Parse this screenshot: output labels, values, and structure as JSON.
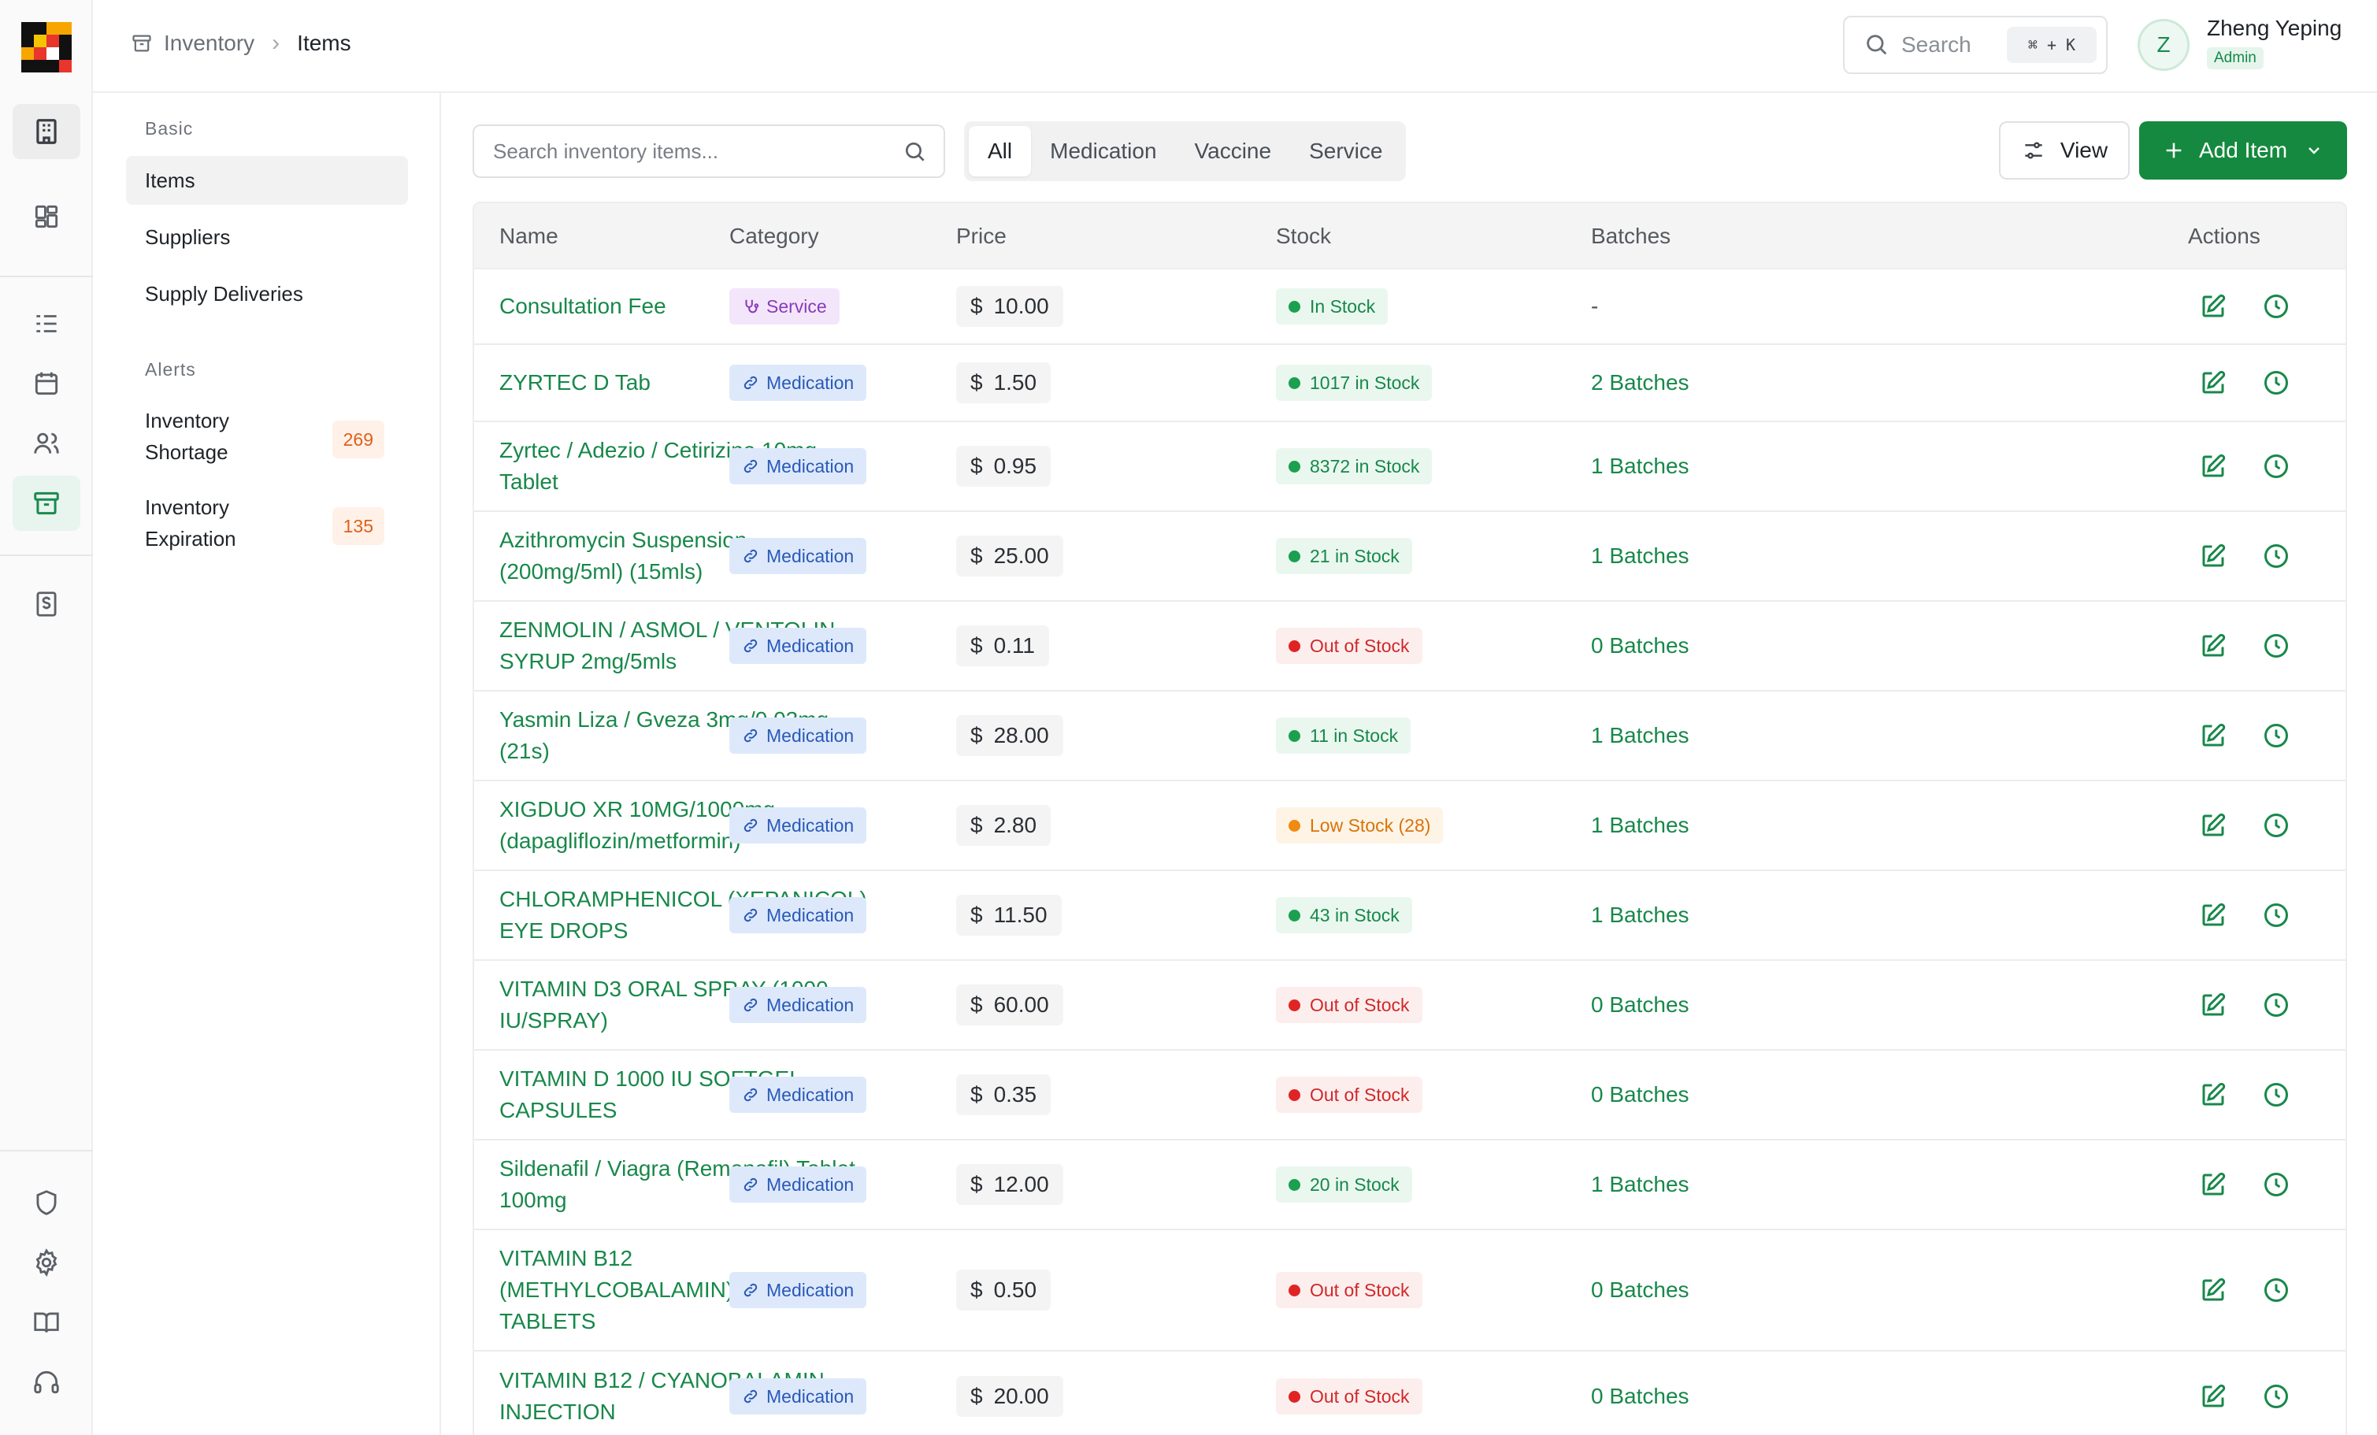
{
  "breadcrumb": {
    "section": "Inventory",
    "page": "Items"
  },
  "header": {
    "search_label": "Search",
    "shortcut": "⌘ + K",
    "user": {
      "initial": "Z",
      "name": "Zheng Yeping",
      "role": "Admin"
    }
  },
  "subnav": {
    "basic_heading": "Basic",
    "basic_items": [
      "Items",
      "Suppliers",
      "Supply Deliveries"
    ],
    "alerts_heading": "Alerts",
    "alerts": [
      {
        "line1": "Inventory",
        "line2": "Shortage",
        "count": "269"
      },
      {
        "line1": "Inventory",
        "line2": "Expiration",
        "count": "135"
      }
    ]
  },
  "toolbar": {
    "search_placeholder": "Search inventory items...",
    "tabs": [
      "All",
      "Medication",
      "Vaccine",
      "Service"
    ],
    "view_label": "View",
    "add_label": "Add Item"
  },
  "table": {
    "columns": [
      "Name",
      "Category",
      "Price",
      "Stock",
      "Batches",
      "Actions"
    ],
    "currency": "$",
    "rows": [
      {
        "name": "Consultation Fee",
        "category": "Service",
        "price": "10.00",
        "stock": "In Stock",
        "stock_level": "green",
        "batches": "-"
      },
      {
        "name": "ZYRTEC D Tab",
        "category": "Medication",
        "price": "1.50",
        "stock": "1017 in Stock",
        "stock_level": "green",
        "batches": "2 Batches"
      },
      {
        "name": "Zyrtec / Adezio / Cetirizine 10mg Tablet",
        "category": "Medication",
        "price": "0.95",
        "stock": "8372 in Stock",
        "stock_level": "green",
        "batches": "1 Batches"
      },
      {
        "name": "Azithromycin Suspension (200mg/5ml) (15mls)",
        "category": "Medication",
        "price": "25.00",
        "stock": "21 in Stock",
        "stock_level": "green",
        "batches": "1 Batches"
      },
      {
        "name": "ZENMOLIN / ASMOL / VENTOLIN SYRUP 2mg/5mls",
        "category": "Medication",
        "price": "0.11",
        "stock": "Out of Stock",
        "stock_level": "red",
        "batches": "0 Batches"
      },
      {
        "name": "Yasmin Liza / Gveza 3mg/0.03mg (21s)",
        "category": "Medication",
        "price": "28.00",
        "stock": "11 in Stock",
        "stock_level": "green",
        "batches": "1 Batches"
      },
      {
        "name": "XIGDUO XR 10MG/1000mg (dapagliflozin/metformin)",
        "category": "Medication",
        "price": "2.80",
        "stock": "Low Stock (28)",
        "stock_level": "orange",
        "batches": "1 Batches"
      },
      {
        "name": "CHLORAMPHENICOL (XEPANICOL) EYE DROPS",
        "category": "Medication",
        "price": "11.50",
        "stock": "43 in Stock",
        "stock_level": "green",
        "batches": "1 Batches"
      },
      {
        "name": "VITAMIN D3 ORAL SPRAY (1000 IU/SPRAY)",
        "category": "Medication",
        "price": "60.00",
        "stock": "Out of Stock",
        "stock_level": "red",
        "batches": "0 Batches"
      },
      {
        "name": "VITAMIN D 1000 IU SOFTGEL CAPSULES",
        "category": "Medication",
        "price": "0.35",
        "stock": "Out of Stock",
        "stock_level": "red",
        "batches": "0 Batches"
      },
      {
        "name": "Sildenafil / Viagra (Remenafil) Tablet 100mg",
        "category": "Medication",
        "price": "12.00",
        "stock": "20 in Stock",
        "stock_level": "green",
        "batches": "1 Batches"
      },
      {
        "name": "VITAMIN B12 (METHYLCOBALAMIN) 500MCG TABLETS",
        "category": "Medication",
        "price": "0.50",
        "stock": "Out of Stock",
        "stock_level": "red",
        "batches": "0 Batches"
      },
      {
        "name": "VITAMIN B12 / CYANOBALAMIN INJECTION",
        "category": "Medication",
        "price": "20.00",
        "stock": "Out of Stock",
        "stock_level": "red",
        "batches": "0 Batches"
      }
    ]
  },
  "colors": {
    "brand_green": "#15893f",
    "link_green": "#18884a",
    "alert_orange": "#e0601a"
  },
  "icons": [
    "logo",
    "building-icon",
    "dashboard-icon",
    "list-icon",
    "calendar-icon",
    "users-icon",
    "archive-icon",
    "invoice-icon",
    "shield-icon",
    "gear-icon",
    "book-icon",
    "headset-icon",
    "search-icon",
    "sliders-icon",
    "plus-icon",
    "chevron-down-icon",
    "link-icon",
    "stethoscope-icon",
    "edit-icon",
    "clock-icon"
  ]
}
